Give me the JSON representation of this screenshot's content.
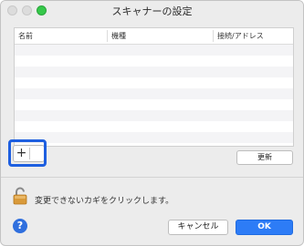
{
  "window": {
    "title": "スキャナーの設定"
  },
  "table": {
    "columns": [
      "名前",
      "機種",
      "接続/アドレス"
    ],
    "rows": []
  },
  "buttons": {
    "add": "+",
    "update": "更新",
    "cancel": "キャンセル",
    "ok": "OK"
  },
  "lock": {
    "text": "変更できないカギをクリックします。"
  },
  "help": {
    "label": "?"
  },
  "colors": {
    "accent": "#2d7cf6",
    "highlight": "#1e5fe0",
    "zoom_green": "#35c84a"
  }
}
